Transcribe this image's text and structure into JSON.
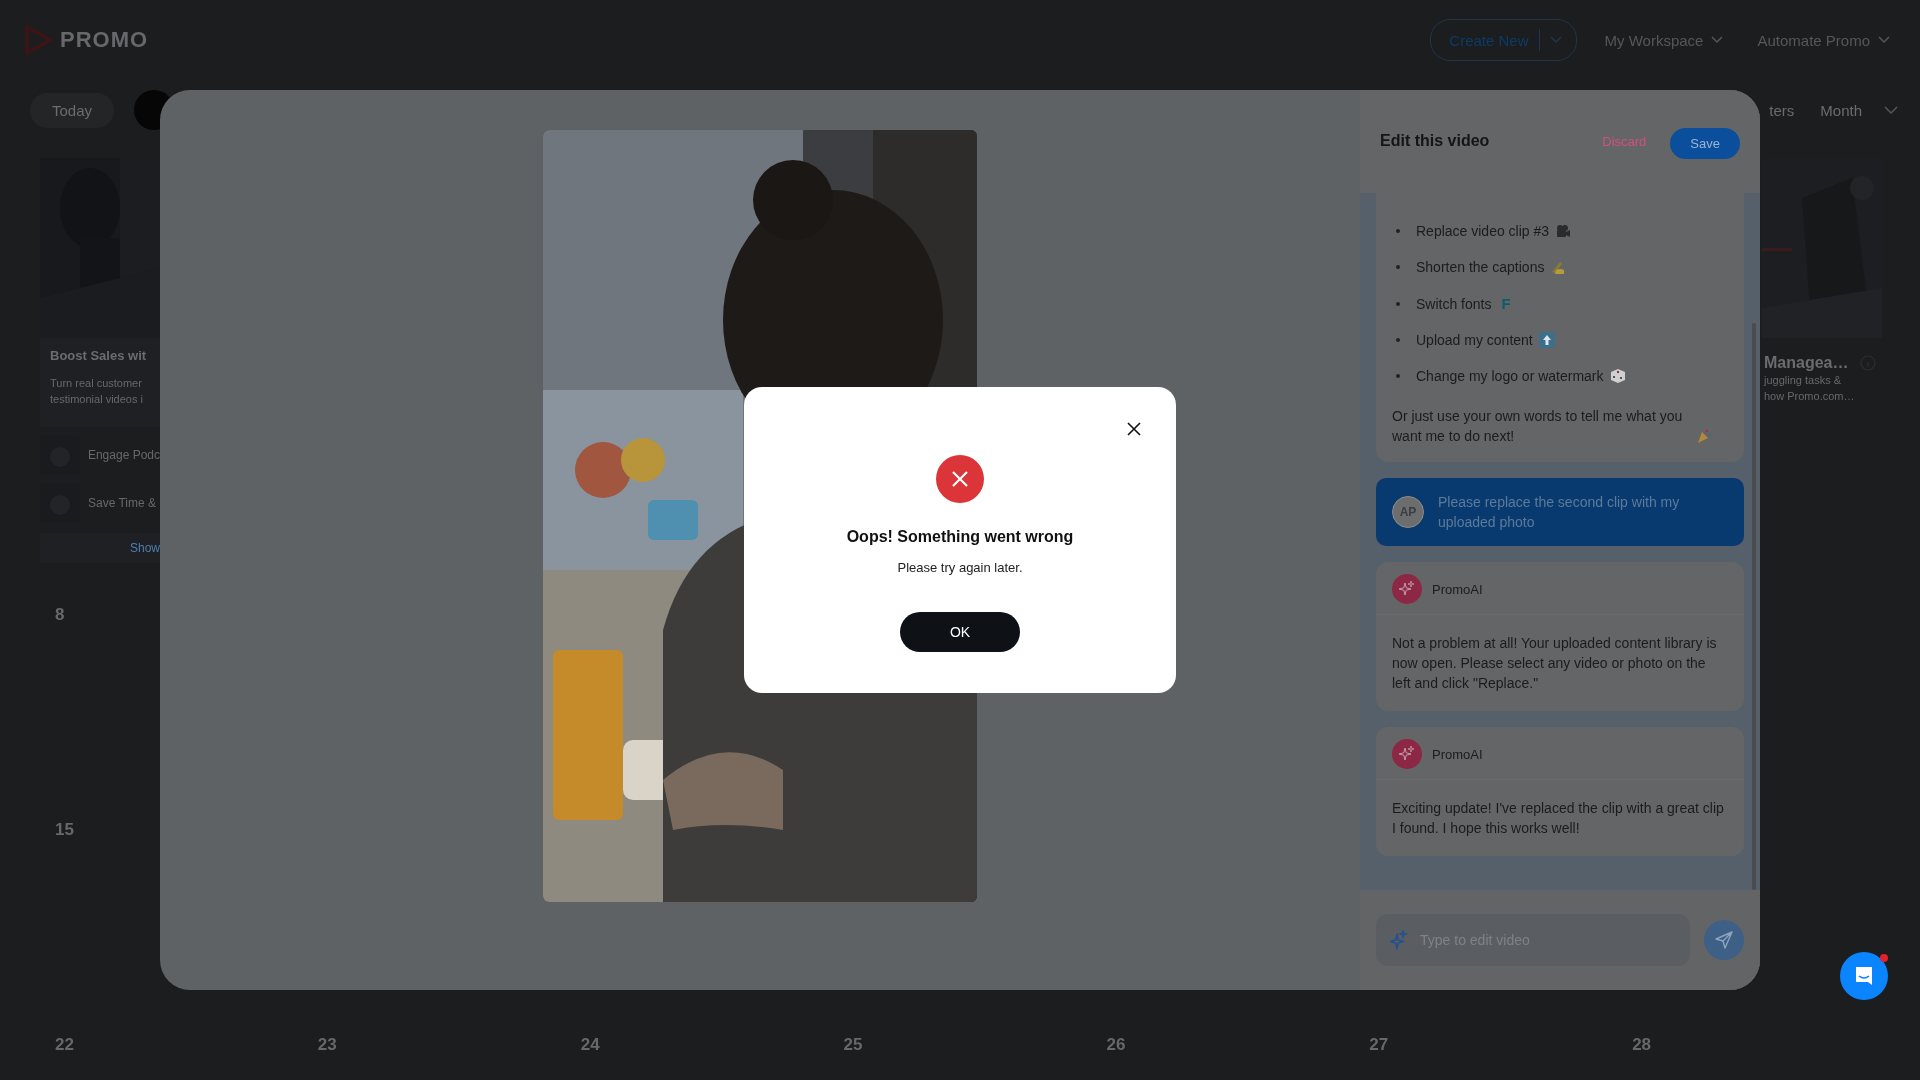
{
  "header": {
    "logo": "PROMO",
    "create_button": "Create New",
    "menus": [
      "My Workspace",
      "Automate Promo"
    ]
  },
  "toolbar": {
    "today": "Today",
    "filters": "ters",
    "view": "Month"
  },
  "calendar": {
    "left_card": {
      "title": "Boost Sales wit",
      "description": [
        "Turn real customer",
        "testimonial videos i"
      ],
      "videos": [
        "Engage Podc",
        "Save Time &"
      ],
      "more": "Show"
    },
    "right_card": {
      "title": "Managea…",
      "description": [
        "juggling tasks &",
        "how Promo.com…"
      ]
    },
    "weeks": [
      [
        "8"
      ],
      [
        "15"
      ],
      [
        "22",
        "23",
        "24",
        "25",
        "26",
        "27",
        "28"
      ]
    ]
  },
  "editor": {
    "title": "Edit this video",
    "discard": "Discard",
    "save": "Save",
    "messages": [
      {
        "kind": "tips",
        "items": [
          {
            "text": "Replace video clip #3"
          },
          {
            "text": "Shorten the captions"
          },
          {
            "text": "Switch fonts",
            "badge": "F"
          },
          {
            "text": "Upload my content"
          },
          {
            "text": "Change my logo or watermark"
          }
        ],
        "footer": "Or just use your own words to tell me what you want me to do next!"
      },
      {
        "kind": "user",
        "avatar": "AP",
        "text": "Please replace the second clip with my uploaded photo"
      },
      {
        "kind": "assistant",
        "sender": "PromoAI",
        "text": "Not a problem at all! Your uploaded content library is now open. Please select any video or photo on the left and click \"Replace.\""
      },
      {
        "kind": "assistant",
        "sender": "PromoAI",
        "text": "Exciting update! I've replaced the clip with a great clip I found. I hope this works well!"
      }
    ],
    "input": {
      "placeholder": "Type to edit video"
    }
  },
  "error_dialog": {
    "title": "Oops! Something went wrong",
    "message": "Please try again later.",
    "button": "OK"
  }
}
